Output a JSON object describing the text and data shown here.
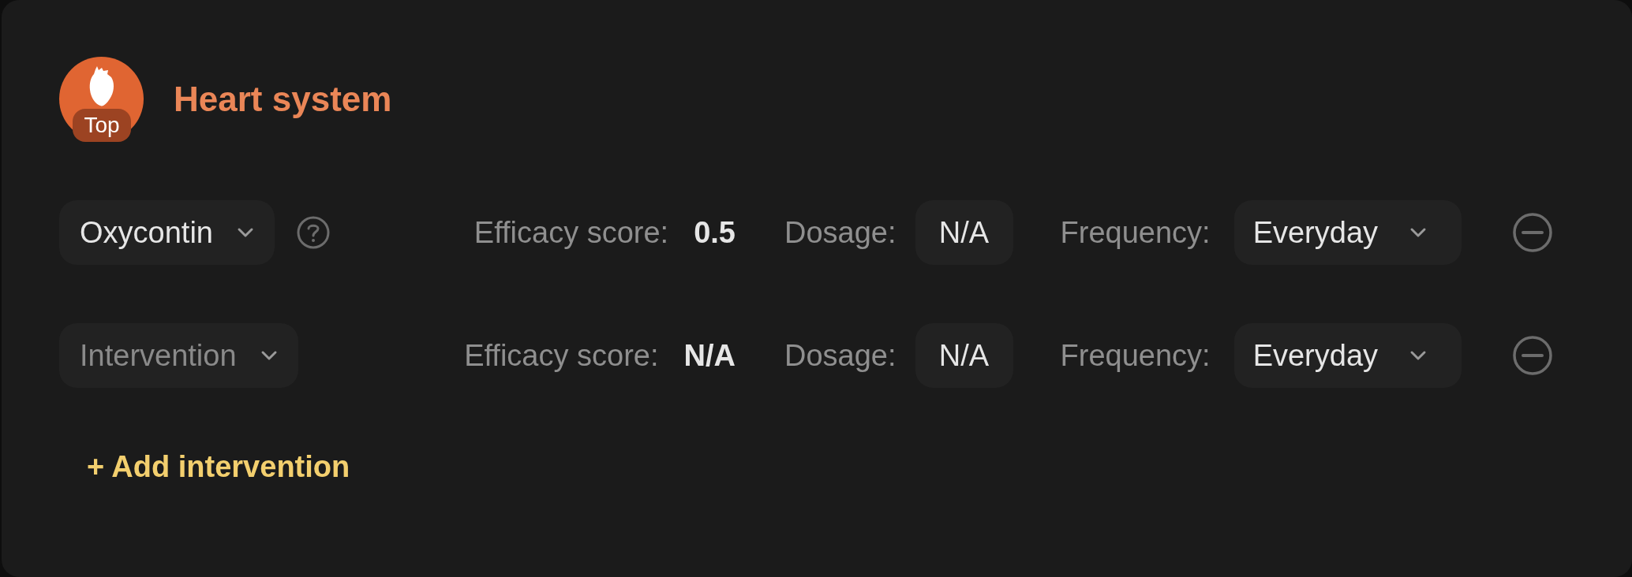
{
  "system": {
    "badge": "Top",
    "title": "Heart system"
  },
  "interventions": [
    {
      "name": "Oxycontin",
      "placeholder": false,
      "help": true,
      "efficacy_label": "Efficacy score:",
      "efficacy": "0.5",
      "dosage_label": "Dosage:",
      "dosage": "N/A",
      "frequency_label": "Frequency:",
      "frequency": "Everyday"
    },
    {
      "name": "Intervention",
      "placeholder": true,
      "help": false,
      "efficacy_label": "Efficacy score:",
      "efficacy": "N/A",
      "dosage_label": "Dosage:",
      "dosage": "N/A",
      "frequency_label": "Frequency:",
      "frequency": "Everyday"
    }
  ],
  "add_button": "+ Add intervention"
}
